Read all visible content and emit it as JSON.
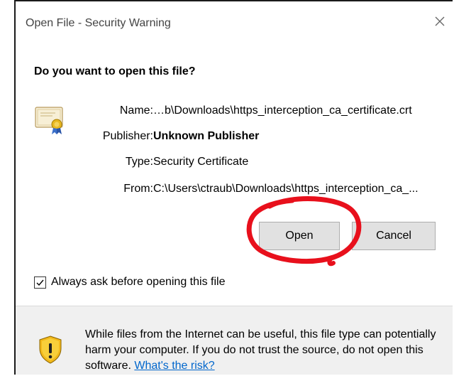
{
  "window": {
    "title": "Open File - Security Warning"
  },
  "dialog": {
    "heading": "Do you want to open this file?",
    "fields": {
      "name_label": "Name:",
      "name_value": "…b\\Downloads\\https_interception_ca_certificate.crt",
      "publisher_label": "Publisher:",
      "publisher_value": "Unknown Publisher",
      "type_label": "Type:",
      "type_value": "Security Certificate",
      "from_label": "From:",
      "from_value": "C:\\Users\\ctraub\\Downloads\\https_interception_ca_..."
    },
    "buttons": {
      "open": "Open",
      "cancel": "Cancel"
    },
    "checkbox": {
      "label": "Always ask before opening this file",
      "checked": true
    }
  },
  "warning": {
    "text": "While files from the Internet can be useful, this file type can potentially harm your computer. If you do not trust the source, do not open this software. ",
    "link": "What's the risk?"
  },
  "colors": {
    "annotation": "#e8101c",
    "link": "#0066cc",
    "panel": "#f0f0f0"
  },
  "icons": {
    "close": "close-icon",
    "certificate": "certificate-icon",
    "shield": "shield-warning-icon",
    "check": "checkmark-icon"
  }
}
